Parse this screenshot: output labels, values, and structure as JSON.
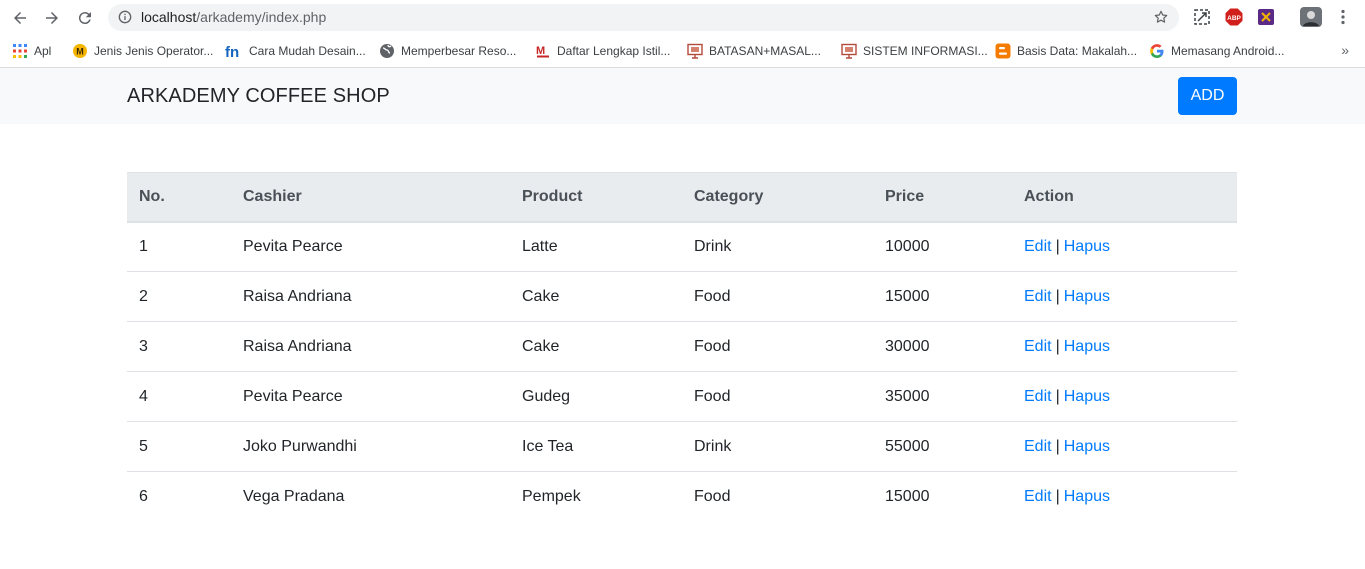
{
  "browser": {
    "url_host": "localhost",
    "url_path": "/arkademy/index.php",
    "bookmarks": [
      {
        "label": "Apl",
        "icon": "apps-grid-icon"
      },
      {
        "label": "Jenis Jenis Operator...",
        "icon": "m-circle-icon"
      },
      {
        "label": "Cara Mudah Desain...",
        "icon": "fn-logo-icon"
      },
      {
        "label": "Memperbesar Reso...",
        "icon": "globe-icon"
      },
      {
        "label": "Daftar Lengkap Istil...",
        "icon": "m-red-logo-icon"
      },
      {
        "label": "BATASAN+MASAL...",
        "icon": "slides-icon"
      },
      {
        "label": "SISTEM INFORMASI...",
        "icon": "slides-icon"
      },
      {
        "label": "Basis Data: Makalah...",
        "icon": "blogger-icon"
      },
      {
        "label": "Memasang Android...",
        "icon": "google-g-icon"
      }
    ],
    "more_label": "»"
  },
  "navbar": {
    "brand": "ARKADEMY COFFEE SHOP",
    "add_label": "ADD"
  },
  "table": {
    "headers": {
      "no": "No.",
      "cashier": "Cashier",
      "product": "Product",
      "category": "Category",
      "price": "Price",
      "action": "Action"
    },
    "rows": [
      {
        "no": "1",
        "cashier": "Pevita Pearce",
        "product": "Latte",
        "category": "Drink",
        "price": "10000",
        "edit": "Edit",
        "sep": "|",
        "hapus": "Hapus"
      },
      {
        "no": "2",
        "cashier": "Raisa Andriana",
        "product": "Cake",
        "category": "Food",
        "price": "15000",
        "edit": "Edit",
        "sep": "|",
        "hapus": "Hapus"
      },
      {
        "no": "3",
        "cashier": "Raisa Andriana",
        "product": "Cake",
        "category": "Food",
        "price": "30000",
        "edit": "Edit",
        "sep": "|",
        "hapus": "Hapus"
      },
      {
        "no": "4",
        "cashier": "Pevita Pearce",
        "product": "Gudeg",
        "category": "Food",
        "price": "35000",
        "edit": "Edit",
        "sep": "|",
        "hapus": "Hapus"
      },
      {
        "no": "5",
        "cashier": "Joko Purwandhi",
        "product": "Ice Tea",
        "category": "Drink",
        "price": "55000",
        "edit": "Edit",
        "sep": "|",
        "hapus": "Hapus"
      },
      {
        "no": "6",
        "cashier": "Vega Pradana",
        "product": "Pempek",
        "category": "Food",
        "price": "15000",
        "edit": "Edit",
        "sep": "|",
        "hapus": "Hapus"
      }
    ]
  },
  "colors": {
    "primary": "#007bff",
    "navbar_bg": "#f8f9fa",
    "table_head_bg": "#e9ecef"
  }
}
